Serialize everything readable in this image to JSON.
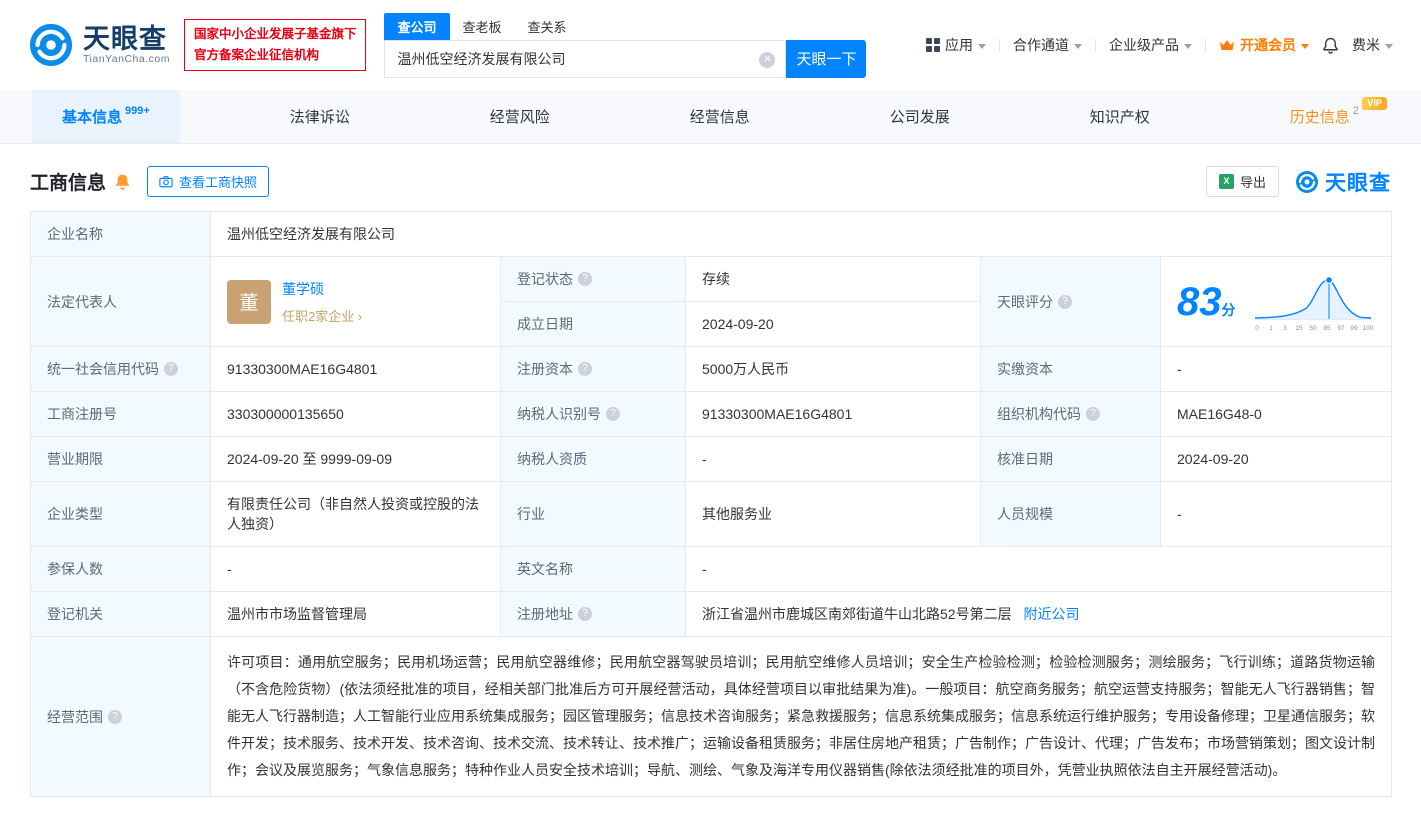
{
  "header": {
    "logo": {
      "name": "天眼查",
      "domain": "TianYanCha.com"
    },
    "badge": {
      "line1": "国家中小企业发展子基金旗下",
      "line2": "官方备案企业征信机构"
    },
    "search": {
      "tabs": [
        {
          "label": "查公司"
        },
        {
          "label": "查老板"
        },
        {
          "label": "查关系"
        }
      ],
      "value": "温州低空经济发展有限公司",
      "button_label": "天眼一下"
    },
    "nav": {
      "apps": "应用",
      "cooperation": "合作通道",
      "enterprise": "企业级产品",
      "vip": "开通会员",
      "user": "费米"
    }
  },
  "tabs": [
    {
      "label": "基本信息",
      "badge": "999+"
    },
    {
      "label": "法律诉讼"
    },
    {
      "label": "经营风险"
    },
    {
      "label": "经营信息"
    },
    {
      "label": "公司发展"
    },
    {
      "label": "知识产权"
    },
    {
      "label": "历史信息",
      "badge": "2",
      "tag": "VIP"
    }
  ],
  "section": {
    "title": "工商信息",
    "snapshot_button": "查看工商快照",
    "export_button": "导出",
    "brand": "天眼查"
  },
  "fields": {
    "company_name": {
      "label": "企业名称",
      "value": "温州低空经济发展有限公司"
    },
    "legal_rep": {
      "label": "法定代表人",
      "avatar": "董",
      "name": "董学硕",
      "note": "任职2家企业 ›"
    },
    "reg_status": {
      "label": "登记状态",
      "value": "存续"
    },
    "establish_date": {
      "label": "成立日期",
      "value": "2024-09-20"
    },
    "score": {
      "label": "天眼评分",
      "value": "83",
      "unit": "分"
    },
    "credit_code": {
      "label": "统一社会信用代码",
      "value": "91330300MAE16G4801"
    },
    "reg_capital": {
      "label": "注册资本",
      "value": "5000万人民币"
    },
    "paid_capital": {
      "label": "实缴资本",
      "value": "-"
    },
    "reg_number": {
      "label": "工商注册号",
      "value": "330300000135650"
    },
    "taxpayer_id": {
      "label": "纳税人识别号",
      "value": "91330300MAE16G4801"
    },
    "org_code": {
      "label": "组织机构代码",
      "value": "MAE16G48-0"
    },
    "business_term": {
      "label": "营业期限",
      "value": "2024-09-20 至 9999-09-09"
    },
    "taxpayer_quality": {
      "label": "纳税人资质",
      "value": "-"
    },
    "approval_date": {
      "label": "核准日期",
      "value": "2024-09-20"
    },
    "company_type": {
      "label": "企业类型",
      "value": "有限责任公司（非自然人投资或控股的法人独资）"
    },
    "industry": {
      "label": "行业",
      "value": "其他服务业"
    },
    "staff_size": {
      "label": "人员规模",
      "value": "-"
    },
    "insured_count": {
      "label": "参保人数",
      "value": "-"
    },
    "english_name": {
      "label": "英文名称",
      "value": "-"
    },
    "reg_authority": {
      "label": "登记机关",
      "value": "温州市市场监督管理局"
    },
    "reg_address": {
      "label": "注册地址",
      "value": "浙江省温州市鹿城区南郊街道牛山北路52号第二层",
      "link": "附近公司"
    },
    "business_scope": {
      "label": "经营范围",
      "value": "许可项目：通用航空服务；民用机场运营；民用航空器维修；民用航空器驾驶员培训；民用航空维修人员培训；安全生产检验检测；检验检测服务；测绘服务；飞行训练；道路货物运输（不含危险货物）(依法须经批准的项目，经相关部门批准后方可开展经营活动，具体经营项目以审批结果为准)。一般项目：航空商务服务；航空运营支持服务；智能无人飞行器销售；智能无人飞行器制造；人工智能行业应用系统集成服务；园区管理服务；信息技术咨询服务；紧急救援服务；信息系统集成服务；信息系统运行维护服务；专用设备修理；卫星通信服务；软件开发；技术服务、技术开发、技术咨询、技术交流、技术转让、技术推广；运输设备租赁服务；非居住房地产租赁；广告制作；广告设计、代理；广告发布；市场营销策划；图文设计制作；会议及展览服务；气象信息服务；特种作业人员安全技术培训；导航、测绘、气象及海洋专用仪器销售(除依法须经批准的项目外，凭营业执照依法自主开展经营活动)。"
    }
  },
  "score_chart": {
    "axis_labels": [
      "0",
      "1",
      "3",
      "15",
      "50",
      "85",
      "97",
      "99",
      "100"
    ]
  }
}
